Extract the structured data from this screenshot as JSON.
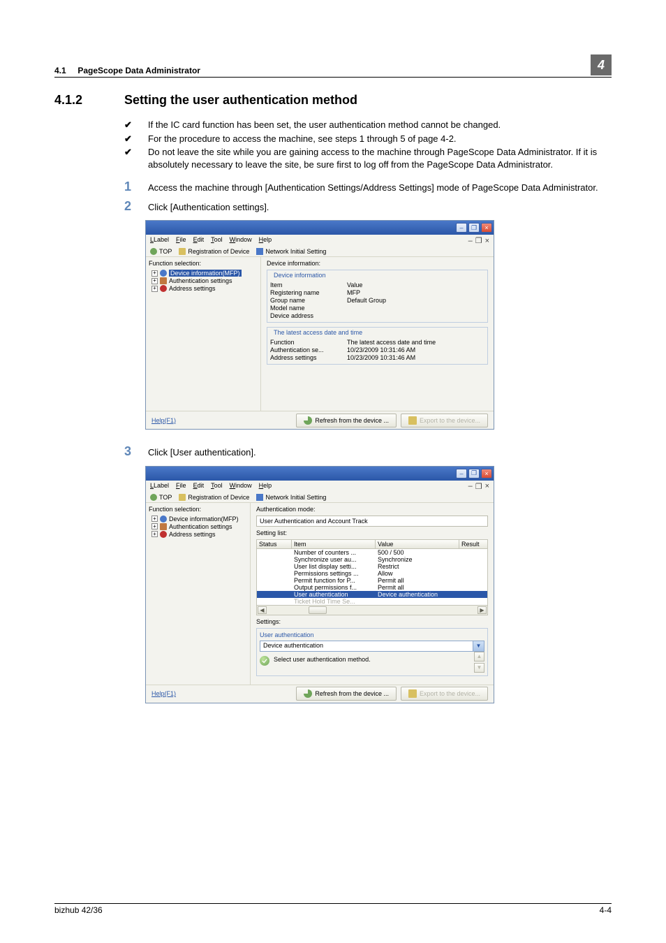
{
  "header": {
    "section_num": "4.1",
    "section_title": "PageScope Data Administrator",
    "chapter_badge": "4"
  },
  "h2": {
    "num": "4.1.2",
    "title": "Setting the user authentication method"
  },
  "bullets": [
    "If the IC card function has been set, the user authentication method cannot be changed.",
    "For the procedure to access the machine, see steps 1 through 5 of page 4-2.",
    "Do not leave the site while you are gaining access to the machine through PageScope Data Administrator. If it is absolutely necessary to leave the site, be sure first to log off from the PageScope Data Administrator."
  ],
  "steps": [
    {
      "n": "1",
      "text": "Access the machine through [Authentication Settings/Address Settings] mode of PageScope Data Administrator."
    },
    {
      "n": "2",
      "text": "Click [Authentication settings]."
    },
    {
      "n": "3",
      "text": "Click [User authentication]."
    }
  ],
  "menubar": {
    "label_full": "Label",
    "file": "File",
    "edit": "Edit",
    "tool": "Tool",
    "window": "Window",
    "help": "Help",
    "min_sym": "–",
    "max_sym": "❐",
    "close_sym": "×"
  },
  "linkbar": {
    "top": "TOP",
    "reg": "Registration of Device",
    "net": "Network Initial Setting"
  },
  "tree": {
    "title": "Function selection:",
    "dev_info": "Device information(MFP)",
    "auth": "Authentication settings",
    "addr": "Address settings"
  },
  "dlg1": {
    "rp_title": "Device information:",
    "box1_title": "Device information",
    "kv1": [
      [
        "Item",
        "Value"
      ],
      [
        "Registering name",
        "MFP"
      ],
      [
        "Group name",
        "Default Group"
      ],
      [
        "Model name",
        ""
      ],
      [
        "Device address",
        ""
      ]
    ],
    "box2_title": "The latest access date and time",
    "kv2": [
      [
        "Function",
        "The latest access date and time"
      ],
      [
        "Authentication se...",
        "10/23/2009 10:31:46 AM"
      ],
      [
        "Address settings",
        "10/23/2009 10:31:46 AM"
      ]
    ]
  },
  "dlg2": {
    "rp_title": "Authentication mode:",
    "mode_field": "User Authentication and Account Track",
    "setlist_label": "Setting list:",
    "hdr": {
      "status": "Status",
      "item": "Item",
      "value": "Value",
      "result": "Result"
    },
    "rows": [
      {
        "item": "Number of counters ...",
        "value": "500 / 500"
      },
      {
        "item": "Synchronize user au...",
        "value": "Synchronize"
      },
      {
        "item": "User list display setti...",
        "value": "Restrict"
      },
      {
        "item": "Permissions settings ...",
        "value": "Allow"
      },
      {
        "item": "Permit function for P...",
        "value": "Permit all"
      },
      {
        "item": "Output permissions f...",
        "value": "Permit all"
      }
    ],
    "sel_row": {
      "item": "User authentication",
      "value": "Device authentication"
    },
    "grey_row": {
      "item": "Ticket Hold Time Se...",
      "value": ""
    },
    "settings_label": "Settings:",
    "group_title": "User authentication",
    "dropdown_value": "Device authentication",
    "hint": "Select user authentication method."
  },
  "statusbar": {
    "help": "Help(F1)",
    "refresh": "Refresh from the device ...",
    "export": "Export to the device..."
  },
  "footer": {
    "left": "bizhub 42/36",
    "right": "4-4"
  }
}
